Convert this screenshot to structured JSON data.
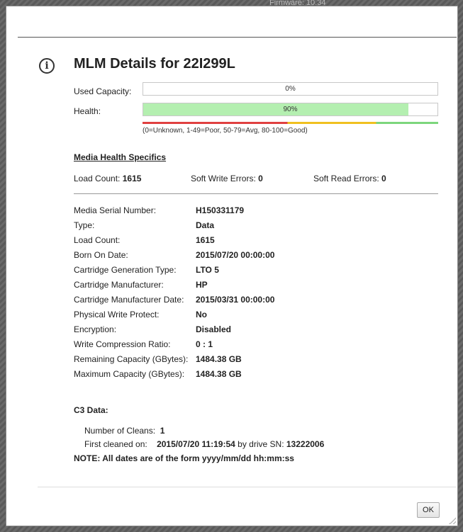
{
  "background": {
    "fragment_text": "Firmware:   10.34"
  },
  "dialog": {
    "title": "MLM Details for 22I299L",
    "used_capacity": {
      "label": "Used Capacity:",
      "value_text": "0%",
      "fraction": 0.0
    },
    "health": {
      "label": "Health:",
      "value_text": "90%",
      "fraction": 0.9
    },
    "health_legend": "(0=Unknown, 1-49=Poor, 50-79=Avg, 80-100=Good)",
    "colors": {
      "health_fill": "#b4efb0",
      "poor": "#e04040",
      "avg": "#f0c020",
      "good": "#7cd67c"
    },
    "media_health_specifics": {
      "heading": "Media Health Specifics",
      "load_count_label": "Load Count:",
      "load_count_value": "1615",
      "soft_write_label": "Soft Write Errors:",
      "soft_write_value": "0",
      "soft_read_label": "Soft Read Errors:",
      "soft_read_value": "0"
    },
    "details": [
      {
        "label": "Media Serial Number:",
        "value": "H150331179"
      },
      {
        "label": "Type:",
        "value": "Data"
      },
      {
        "label": "Load Count:",
        "value": "1615"
      },
      {
        "label": "Born On Date:",
        "value": "2015/07/20 00:00:00"
      },
      {
        "label": "Cartridge Generation Type:",
        "value": "LTO 5"
      },
      {
        "label": "Cartridge Manufacturer:",
        "value": "HP"
      },
      {
        "label": "Cartridge Manufacturer Date:",
        "value": "2015/03/31 00:00:00"
      },
      {
        "label": "Physical Write Protect:",
        "value": "No"
      },
      {
        "label": "Encryption:",
        "value": "Disabled"
      },
      {
        "label": "Write Compression Ratio:",
        "value": "0 : 1"
      },
      {
        "label": "Remaining Capacity (GBytes):",
        "value": "1484.38 GB"
      },
      {
        "label": "Maximum Capacity (GBytes):",
        "value": "1484.38 GB"
      }
    ],
    "c3": {
      "heading": "C3 Data:",
      "cleans_label": "Number of Cleans:",
      "cleans_value": "1",
      "first_cleaned_label": "First cleaned on:",
      "first_cleaned_value": "2015/07/20 11:19:54",
      "by_drive_label": "by drive SN:",
      "drive_sn": "13222006"
    },
    "note": "NOTE: All dates are of the form yyyy/mm/dd hh:mm:ss",
    "ok_label": "OK"
  }
}
